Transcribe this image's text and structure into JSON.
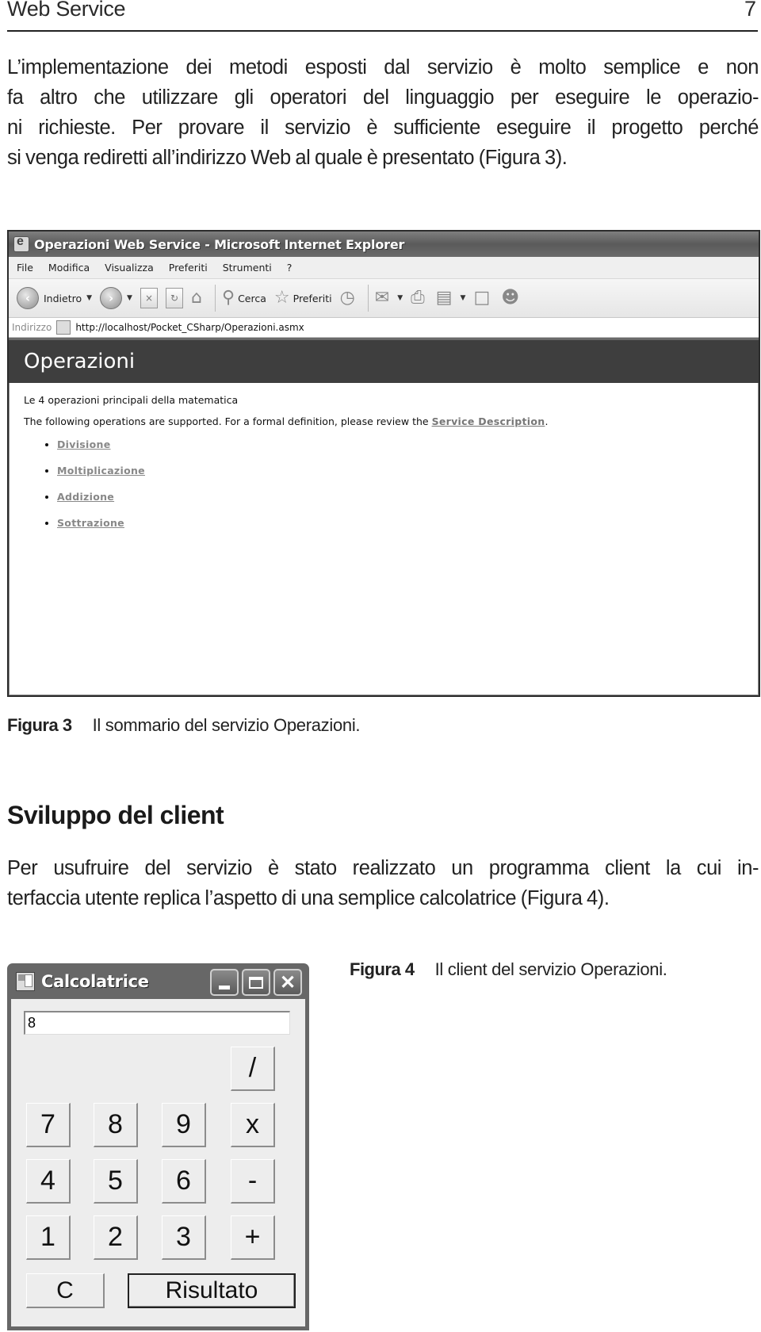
{
  "running_head": {
    "section": "Web Service",
    "page_number": "7"
  },
  "paragraph_1": {
    "lines": [
      "L’implementazione dei metodi esposti dal servizio è molto semplice e non",
      "fa altro che utilizzare gli operatori del linguaggio per eseguire le operazio-",
      "ni richieste. Per provare il servizio è sufficiente eseguire il progetto perché",
      "si venga rediretti all’indirizzo Web al quale è presentato (Figura 3)."
    ]
  },
  "figure_3": {
    "browser": {
      "title": "Operazioni Web Service - Microsoft Internet Explorer",
      "menu": [
        "File",
        "Modifica",
        "Visualizza",
        "Preferiti",
        "Strumenti",
        "?"
      ],
      "toolbar": {
        "back_label": "Indietro",
        "search_label": "Cerca",
        "favorites_label": "Preferiti",
        "icons": [
          "back-icon",
          "forward-icon",
          "stop-icon",
          "refresh-icon",
          "home-icon",
          "search-icon",
          "favorites-star-icon",
          "history-icon",
          "mail-icon",
          "print-icon",
          "edit-icon",
          "discuss-icon",
          "messenger-icon"
        ]
      },
      "address_label": "Indirizzo",
      "address_url": "http://localhost/Pocket_CSharp/Operazioni.asmx"
    },
    "service_page": {
      "title": "Operazioni",
      "description": "Le 4 operazioni principali della matematica",
      "supported_text": "The following operations are supported. For a formal definition, please review the ",
      "service_description_link": "Service Description",
      "supported_text_end": ".",
      "operations": [
        "Divisione",
        "Moltiplicazione",
        "Addizione",
        "Sottrazione"
      ]
    },
    "caption_label": "Figura 3",
    "caption_text": "Il sommario del servizio Operazioni."
  },
  "section_heading": "Sviluppo del client",
  "paragraph_2": {
    "lines": [
      "Per usufruire del servizio è stato realizzato un programma client la cui in-",
      "terfaccia utente replica l’aspetto di una semplice calcolatrice (Figura 4)."
    ]
  },
  "figure_4": {
    "window_title": "Calcolatrice",
    "display_value": "8",
    "buttons": {
      "divide": "/",
      "multiply": "x",
      "minus": "-",
      "plus": "+",
      "d7": "7",
      "d8": "8",
      "d9": "9",
      "d4": "4",
      "d5": "5",
      "d6": "6",
      "d1": "1",
      "d2": "2",
      "d3": "3",
      "clear": "C",
      "result": "Risultato"
    },
    "caption_label": "Figura 4",
    "caption_text": "Il client del servizio Operazioni."
  }
}
